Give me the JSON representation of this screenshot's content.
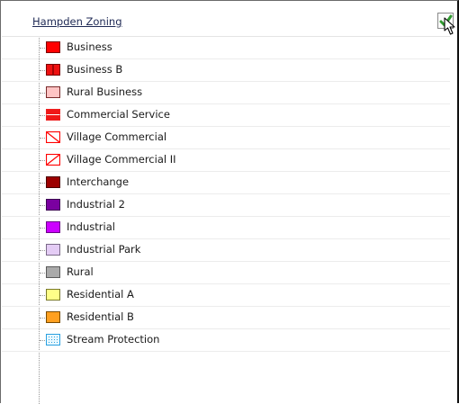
{
  "layer": {
    "title": "Hampden Zoning",
    "visible": true
  },
  "icons": {
    "toggle": "checkmark-icon"
  },
  "legend": [
    {
      "label": "Business",
      "fill": "#ff0000",
      "border": "#7a0000",
      "pattern": "solid"
    },
    {
      "label": "Business B",
      "fill": "#ee1111",
      "border": "#7a0000",
      "pattern": "split"
    },
    {
      "label": "Rural Business",
      "fill": "#ffc4c4",
      "border": "#7a2a2a",
      "pattern": "solid"
    },
    {
      "label": "Commercial Service",
      "fill": "#f01818",
      "border": "#ee2020",
      "pattern": "band"
    },
    {
      "label": "Village Commercial",
      "fill": "#ffffff",
      "border": "#ff0000",
      "pattern": "hatch"
    },
    {
      "label": "Village Commercial II",
      "fill": "#ffffff",
      "border": "#ff0000",
      "pattern": "hatch-rev"
    },
    {
      "label": "Interchange",
      "fill": "#9c0000",
      "border": "#4a0000",
      "pattern": "solid"
    },
    {
      "label": "Industrial 2",
      "fill": "#7a00a0",
      "border": "#3a0050",
      "pattern": "solid"
    },
    {
      "label": "Industrial",
      "fill": "#cc00ff",
      "border": "#6a0088",
      "pattern": "solid"
    },
    {
      "label": "Industrial Park",
      "fill": "#e4ccf5",
      "border": "#7a6a88",
      "pattern": "solid"
    },
    {
      "label": "Rural",
      "fill": "#aaaaaa",
      "border": "#5a5a5a",
      "pattern": "solid"
    },
    {
      "label": "Residential A",
      "fill": "#ffff88",
      "border": "#7a7a2a",
      "pattern": "solid"
    },
    {
      "label": "Residential B",
      "fill": "#ffa020",
      "border": "#7a4a00",
      "pattern": "solid"
    },
    {
      "label": "Stream Protection",
      "fill": "#e8f8ff",
      "border": "#2aa0e0",
      "pattern": "dots"
    }
  ]
}
